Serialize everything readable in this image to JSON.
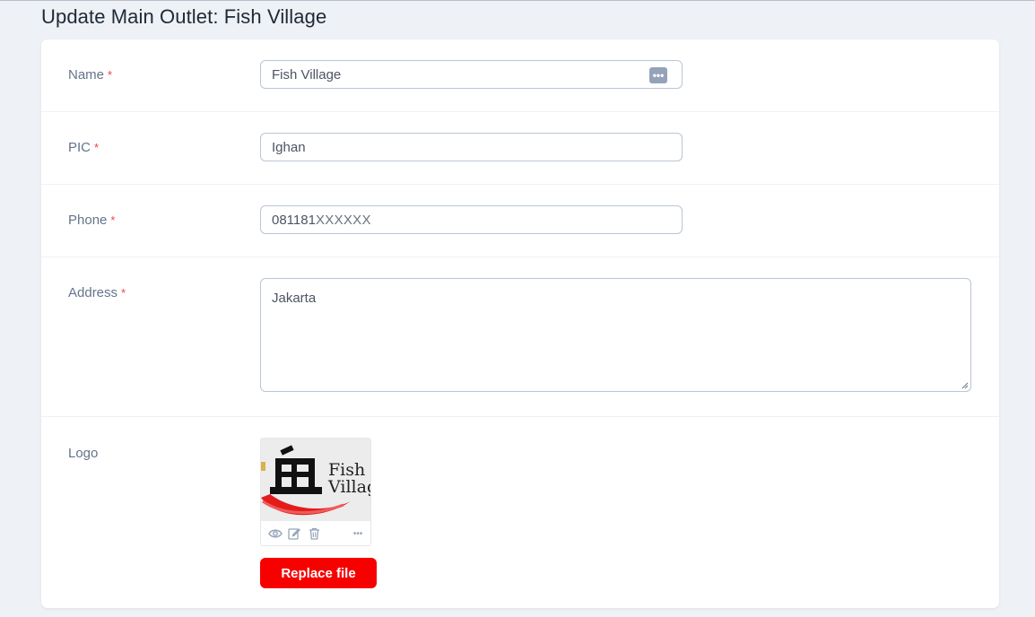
{
  "page": {
    "title": "Update Main Outlet: Fish Village"
  },
  "form": {
    "required_mark": "*",
    "name": {
      "label": "Name",
      "value": "Fish Village",
      "badge": "•••"
    },
    "pic": {
      "label": "PIC",
      "value": "Ighan"
    },
    "phone": {
      "label": "Phone",
      "value_prefix": "081181",
      "value_masked": "XXXXXX"
    },
    "address": {
      "label": "Address",
      "value": "Jakarta"
    },
    "logo": {
      "label": "Logo",
      "image_text_line1": "Fish",
      "image_text_line2": "Villag",
      "more": "•••",
      "replace_label": "Replace file"
    }
  },
  "colors": {
    "accent_button": "#f70000",
    "required": "#ef4444",
    "input_border": "#b9c6d3",
    "background": "#eef1f5"
  },
  "icons": {
    "name_field_badge": "more-dots-icon",
    "logo_preview": "eye-icon",
    "logo_edit": "edit-icon",
    "logo_delete": "trash-icon",
    "logo_more": "more-horizontal-icon"
  }
}
